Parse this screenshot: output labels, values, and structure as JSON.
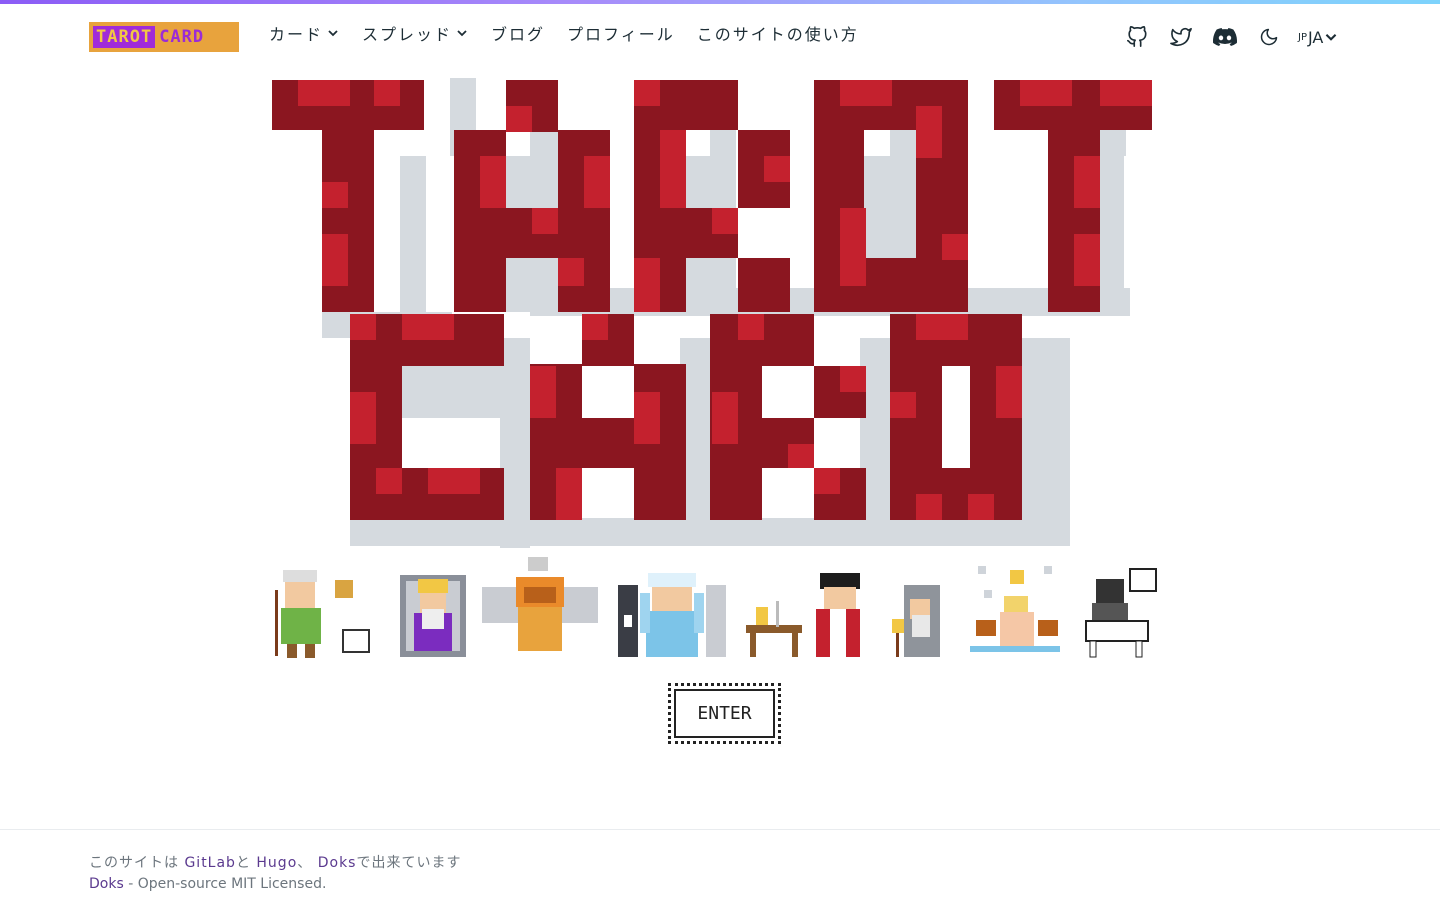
{
  "header": {
    "logo": {
      "word1": "TAROT",
      "word2": "CARD"
    },
    "nav": [
      {
        "label": "カード",
        "dropdown": true
      },
      {
        "label": "スプレッド",
        "dropdown": true
      },
      {
        "label": "ブログ",
        "dropdown": false
      },
      {
        "label": "プロフィール",
        "dropdown": false
      },
      {
        "label": "このサイトの使い方",
        "dropdown": false
      }
    ],
    "icons": [
      "github-icon",
      "twitter-icon",
      "discord-icon",
      "dark-mode-moon-icon"
    ],
    "language": {
      "small": "JP",
      "code": "JA"
    }
  },
  "hero": {
    "title_line1": "TAROT",
    "title_line2": "CARD",
    "colors": {
      "dark_red": "#8b1620",
      "red": "#c4212e",
      "shadow": "#d5dadf"
    },
    "characters": [
      "fool",
      "emperor",
      "dragon",
      "high-priestess",
      "magician",
      "hermit",
      "star",
      "death-knight"
    ]
  },
  "enter_button": {
    "label": "ENTER"
  },
  "footer": {
    "line1_prefix": "このサイトは",
    "link_gitlab": "GitLab",
    "conj_to": "と",
    "link_hugo": "Hugo",
    "comma": "、",
    "link_doks": "Doks",
    "line1_suffix": "で出来ています",
    "line2_link": "Doks",
    "line2_text": " - Open-source MIT Licensed."
  },
  "colors": {
    "accent": "#8b5cf6",
    "link": "#5b3a8f"
  }
}
